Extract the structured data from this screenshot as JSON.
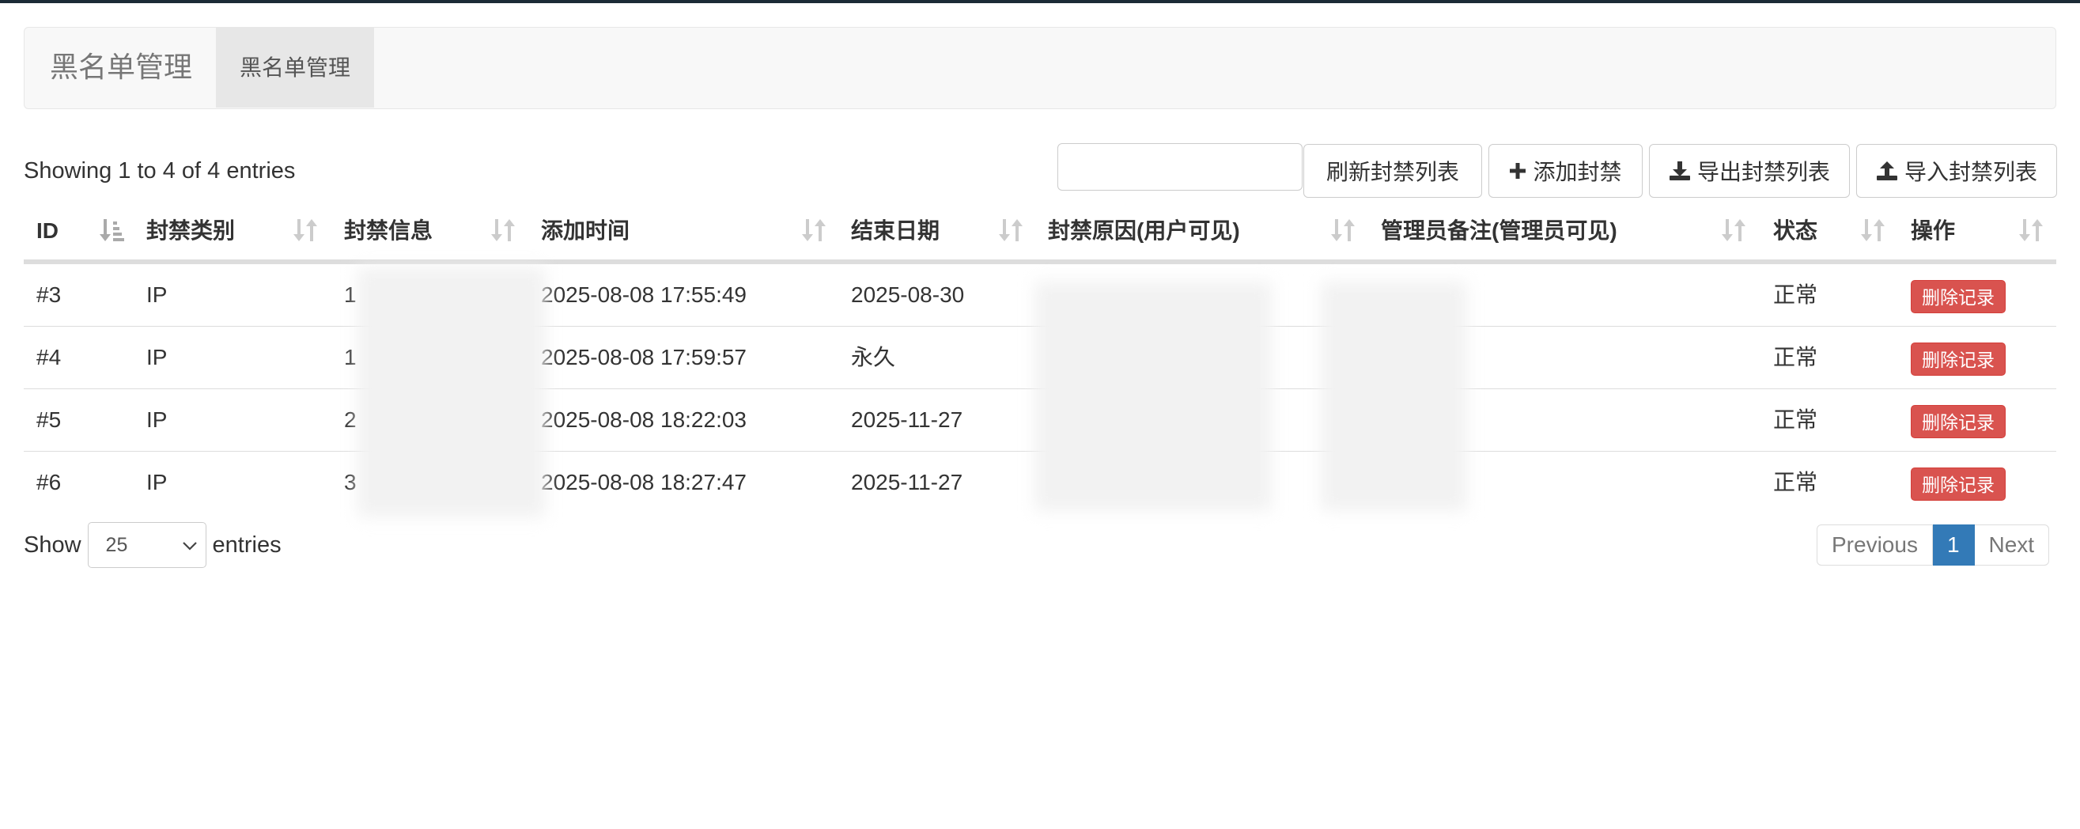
{
  "navbar": {
    "brand": "黑名单管理",
    "tab": "黑名单管理"
  },
  "table_info": "Showing 1 to 4 of 4 entries",
  "search": {
    "value": ""
  },
  "toolbar": {
    "refresh_label": "刷新封禁列表",
    "add_label": "添加封禁",
    "export_label": "导出封禁列表",
    "import_label": "导入封禁列表"
  },
  "columns": [
    "ID",
    "封禁类别",
    "封禁信息",
    "添加时间",
    "结束日期",
    "封禁原因(用户可见)",
    "管理员备注(管理员可见)",
    "状态",
    "操作"
  ],
  "rows": [
    {
      "id": "#3",
      "type": "IP",
      "info": "1",
      "added": "2025-08-08 17:55:49",
      "end": "2025-08-30",
      "reason": "",
      "note": "",
      "status": "正常",
      "action": "删除记录"
    },
    {
      "id": "#4",
      "type": "IP",
      "info": "1",
      "added": "2025-08-08 17:59:57",
      "end": "永久",
      "reason": "",
      "note": "",
      "status": "正常",
      "action": "删除记录"
    },
    {
      "id": "#5",
      "type": "IP",
      "info": "2",
      "added": "2025-08-08 18:22:03",
      "end": "2025-11-27",
      "reason": "",
      "note": "",
      "status": "正常",
      "action": "删除记录"
    },
    {
      "id": "#6",
      "type": "IP",
      "info": "3",
      "added": "2025-08-08 18:27:47",
      "end": "2025-11-27",
      "reason": "",
      "note": "",
      "status": "正常",
      "action": "删除记录"
    }
  ],
  "length_menu": {
    "prefix": "Show",
    "selected": "25",
    "suffix": "entries"
  },
  "pagination": {
    "previous": "Previous",
    "current": "1",
    "next": "Next"
  },
  "icons": {
    "sort_active": "sort-amount-asc-icon",
    "sort": "sort-both-icon",
    "add": "plus-icon",
    "export": "download-icon",
    "import": "upload-icon",
    "select": "chevron-down-icon"
  },
  "colors": {
    "danger": "#d9534f",
    "primary": "#337ab7",
    "navbar_bg": "#f8f8f8",
    "top_border": "#1c2b36"
  }
}
